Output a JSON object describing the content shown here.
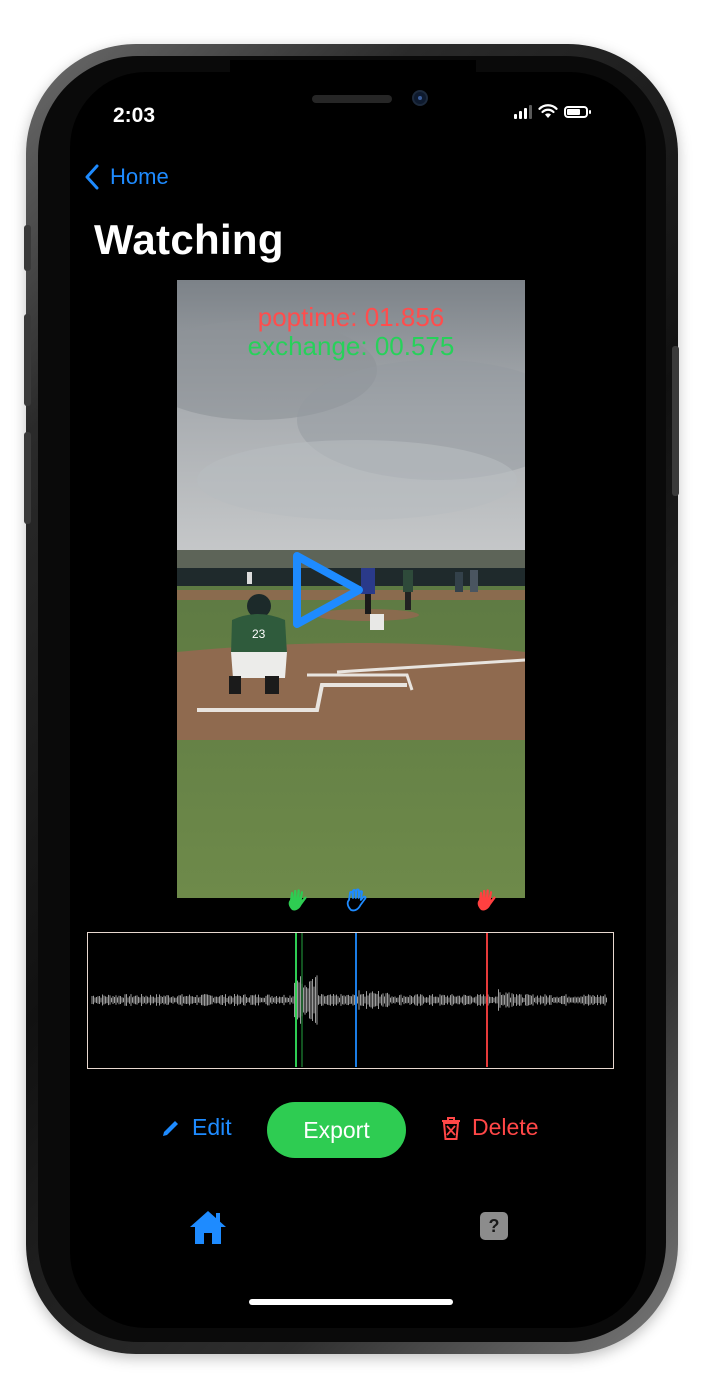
{
  "status_bar": {
    "time": "2:03"
  },
  "nav": {
    "back_label": "Home"
  },
  "page": {
    "title": "Watching"
  },
  "video": {
    "poptime_text": "poptime: 01.856",
    "exchange_text": "exchange: 00.575"
  },
  "actions": {
    "edit_label": "Edit",
    "export_label": "Export",
    "delete_label": "Delete"
  },
  "tabbar": {
    "help_label": "?"
  },
  "colors": {
    "accent_blue": "#1e8bff",
    "export_green": "#2ecc52",
    "delete_red": "#ff4747",
    "marker_green": "#2ecc52",
    "marker_blue": "#1e8bff",
    "marker_red": "#ff4040"
  },
  "icons": [
    "back-chevron-icon",
    "play-icon",
    "hand-marker-icon",
    "pencil-icon",
    "trash-icon",
    "home-icon",
    "help-icon"
  ]
}
